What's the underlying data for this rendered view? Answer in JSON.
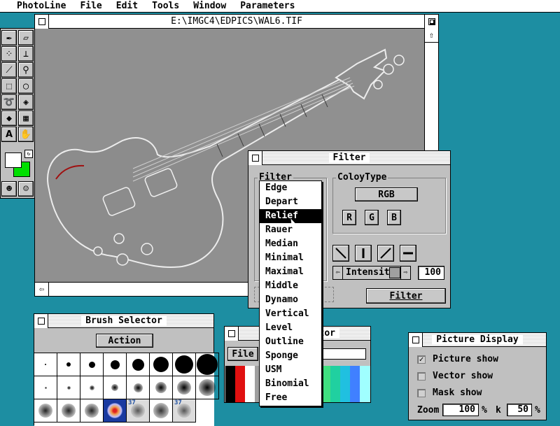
{
  "menubar": {
    "items": [
      "PhotoLine",
      "File",
      "Edit",
      "Tools",
      "Window",
      "Parameters"
    ]
  },
  "image_window": {
    "title": "E:\\IMGC4\\EDPICS\\WAL6.TIF"
  },
  "toolbox": {
    "tools": [
      "pen-icon",
      "eraser-icon",
      "scatter-icon",
      "stamp-icon",
      "eyedropper-icon",
      "magnifier-icon",
      "rect-select-icon",
      "ellipse-select-icon",
      "lasso-icon",
      "bucket-icon",
      "fill-icon",
      "gradient-icon",
      "text-icon",
      "hand-icon",
      "mask-icon",
      "mask-edit-icon"
    ],
    "fg_color": "#ffffff",
    "bg_color": "#00e000"
  },
  "filter_dialog": {
    "title": "Filter",
    "filter_group_label": "Filter",
    "color_group_label": "ColoyType",
    "color_type_value": "RGB",
    "channels": [
      "R",
      "G",
      "B"
    ],
    "intensity_label": "Intensity",
    "intensity_value": "100",
    "apply_label": "Filter",
    "filters": [
      "Edge",
      "Depart",
      "Relief",
      "Rauer",
      "Median",
      "Minimal",
      "Maximal",
      "Middle",
      "Dynamo",
      "Vertical",
      "Level",
      "Outline",
      "Sponge",
      "USM",
      "Binomial",
      "Free"
    ],
    "selected_filter": "Relief"
  },
  "brush_selector": {
    "title": "Brush Selector",
    "action_label": "Action",
    "badge_label": "37"
  },
  "color_selector": {
    "title_visible": "ctor",
    "file_label": "File"
  },
  "picture_display": {
    "title": "Picture Display",
    "options": [
      {
        "label": "Picture show",
        "checked": true
      },
      {
        "label": "Vector show",
        "checked": false
      },
      {
        "label": "Mask show",
        "checked": false
      }
    ],
    "zoom_label": "Zoom",
    "zoom_value": "100",
    "zoom_unit": "%",
    "k_label": "k",
    "k_value": "50",
    "k_unit": "%"
  }
}
